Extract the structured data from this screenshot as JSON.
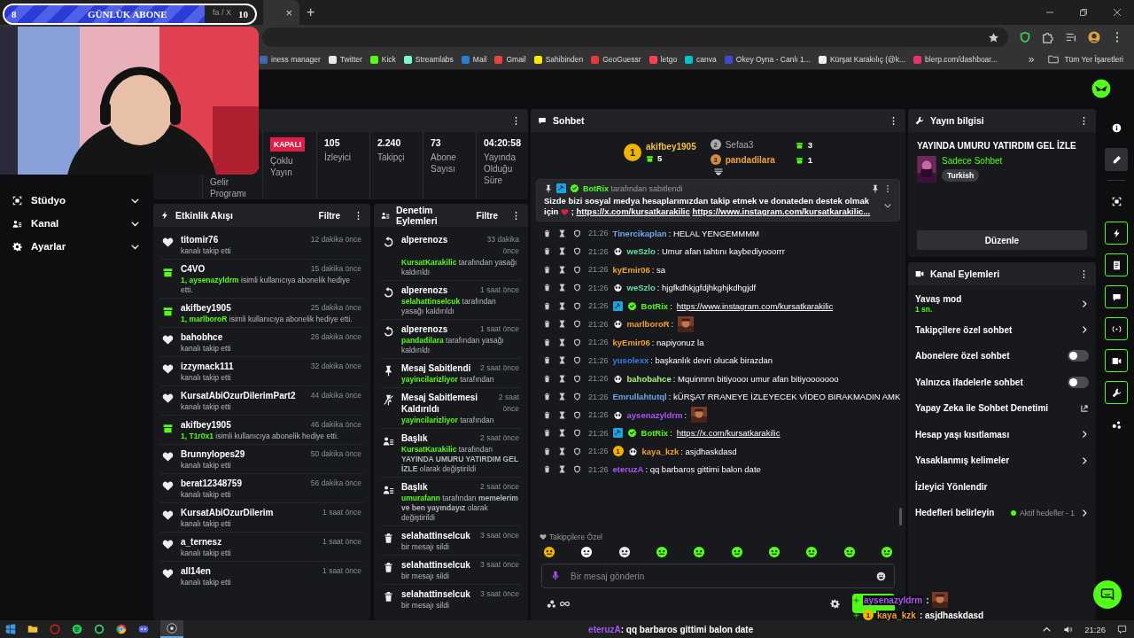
{
  "stream_overlay": {
    "goal": {
      "current": "8",
      "label": "GÜNLÜK ABONE",
      "target": "10",
      "level": 0.8
    },
    "chat": [
      {
        "user": "aysenazyldrm",
        "color": "#a855f7",
        "text": ":",
        "emote": true
      },
      {
        "user": "kaya_kzk",
        "color": "#f0a030",
        "badge": "1",
        "text": ": asjdhaskdasd"
      },
      {
        "user": "eteruzA",
        "color": "#a855f7",
        "text": ": qq barbaros gittimi balon date"
      }
    ]
  },
  "browser": {
    "tab_title": "fa / X",
    "close": "×",
    "new_tab": "+",
    "bookmarks": [
      {
        "label": "iness manager",
        "color": "#4267b2"
      },
      {
        "label": "Twitter",
        "color": "#e7e9ea"
      },
      {
        "label": "Kick",
        "color": "#53fc18"
      },
      {
        "label": "Streamlabs",
        "color": "#80f5d2"
      },
      {
        "label": "Mail",
        "color": "#2b7cd3"
      },
      {
        "label": "Gmail",
        "color": "#ea4335"
      },
      {
        "label": "Sahibinden",
        "color": "#ffe800"
      },
      {
        "label": "GeoGuessr",
        "color": "#e53935"
      },
      {
        "label": "letgo",
        "color": "#ff3f55"
      },
      {
        "label": "canva",
        "color": "#00c4cc"
      },
      {
        "label": "Okey Oyna - Canlı 1...",
        "color": "#3b4bd8"
      },
      {
        "label": "Kürşat Karakılıç (@k...",
        "color": "#eeeeee"
      },
      {
        "label": "blerp.com/dashboar...",
        "color": "#e8336a"
      }
    ],
    "more": "»",
    "all_bookmarks": "Tüm Yer İşaretleri"
  },
  "sidebar": {
    "items": [
      {
        "label": "Stüdyo",
        "expanded": false
      },
      {
        "label": "Kanal",
        "expanded": false
      },
      {
        "label": "Ayarlar",
        "expanded": false
      }
    ]
  },
  "stats": [
    {
      "kind": "label",
      "label": "Gelir Programı"
    },
    {
      "kind": "badge",
      "badge": "KAPALI",
      "label": "Çoklu Yayın"
    },
    {
      "kind": "number",
      "value": "105",
      "label": "İzleyici"
    },
    {
      "kind": "number",
      "value": "2.240",
      "label": "Takipçi"
    },
    {
      "kind": "number",
      "value": "73",
      "label": "Abone Sayısı"
    },
    {
      "kind": "number",
      "value": "04:20:58",
      "label": "Yayında Olduğu Süre"
    }
  ],
  "activity": {
    "title": "Etkinlik Akışı",
    "filter": "Filtre",
    "events": [
      {
        "kind": "follow",
        "user": "titomir76",
        "time": "12 dakika önce",
        "text": "kanalı takip etti"
      },
      {
        "kind": "gift",
        "user": "C4VO",
        "time": "15 dakika önce",
        "highlight": "1, aysenazyldrm",
        "text": "isimli kullanıcıya abonelik hediye etti."
      },
      {
        "kind": "gift",
        "user": "akifbey1905",
        "time": "25 dakika önce",
        "highlight": "1, marlboroR",
        "text": "isimli kullanıcıya abonelik hediye etti."
      },
      {
        "kind": "follow",
        "user": "bahobhce",
        "time": "26 dakika önce",
        "text": "kanalı takip etti"
      },
      {
        "kind": "follow",
        "user": "izzymack111",
        "time": "32 dakika önce",
        "text": "kanalı takip etti"
      },
      {
        "kind": "follow",
        "user": "KursatAbiOzurDilerimPart2",
        "time": "44 dakika önce",
        "text": "kanalı takip etti"
      },
      {
        "kind": "gift",
        "user": "akifbey1905",
        "time": "46 dakika önce",
        "highlight": "1, T1r0x1",
        "text": "isimli kullanıcıya abonelik hediye etti."
      },
      {
        "kind": "follow",
        "user": "Brunnylopes29",
        "time": "50 dakika önce",
        "text": "kanalı takip etti"
      },
      {
        "kind": "follow",
        "user": "berat12348759",
        "time": "56 dakika önce",
        "text": "kanalı takip etti"
      },
      {
        "kind": "follow",
        "user": "KursatAbiOzurDilerim",
        "time": "1 saat önce",
        "text": "kanalı takip etti"
      },
      {
        "kind": "follow",
        "user": "a_ternesz",
        "time": "1 saat önce",
        "text": "kanalı takip etti"
      },
      {
        "kind": "follow",
        "user": "all14en",
        "time": "1 saat önce",
        "text": "kanalı takip etti"
      }
    ]
  },
  "moderation": {
    "title": "Denetim Eylemleri",
    "filter": "Filtre",
    "actions": [
      {
        "kind": "unban",
        "title": "alperenozs",
        "time": "33 dakika önce",
        "actor": "KursatKarakilic",
        "text": "tarafından yasağı kaldırıldı"
      },
      {
        "kind": "unban",
        "title": "alperenozs",
        "time": "1 saat önce",
        "actor": "selahattinselcuk",
        "text": "tarafından yasağı kaldırıldı"
      },
      {
        "kind": "unban",
        "title": "alperenozs",
        "time": "1 saat önce",
        "actor": "pandadilara",
        "text": "tarafından yasağı kaldırıldı"
      },
      {
        "kind": "pin",
        "title": "Mesaj Sabitlendi",
        "time": "2 saat önce",
        "actor": "yayincilarizliyor",
        "text": "tarafından"
      },
      {
        "kind": "unpin",
        "title": "Mesaj Sabitlemesi Kaldırıldı",
        "time": "2 saat önce",
        "actor": "yayincilarizliyor",
        "text": "tarafından"
      },
      {
        "kind": "title",
        "title": "Başlık",
        "time": "2 saat önce",
        "actor": "KursatKarakilic",
        "text": "tarafından **YAYINDA UMURU YATIRDIM GEL İZLE** olarak değiştirildi"
      },
      {
        "kind": "title",
        "title": "Başlık",
        "time": "2 saat önce",
        "actor": "umurafann",
        "text": "tarafından **memelerim ve ben yayındayız** olarak değiştirildi"
      },
      {
        "kind": "delete",
        "title": "selahattinselcuk",
        "time": "3 saat önce",
        "text": "bir mesajı sildi"
      },
      {
        "kind": "delete",
        "title": "selahattinselcuk",
        "time": "3 saat önce",
        "text": "bir mesajı sildi"
      },
      {
        "kind": "delete",
        "title": "selahattinselcuk",
        "time": "3 saat önce",
        "text": "bir mesajı sildi"
      }
    ]
  },
  "chat": {
    "title": "Sohbet",
    "leaders": [
      {
        "rank": "1",
        "user": "akifbey1905",
        "count": "5"
      },
      {
        "rank": "2",
        "user": "Sefaa3",
        "count": "3"
      },
      {
        "rank": "3",
        "user": "pandadilara",
        "count": "1"
      }
    ],
    "pinned": {
      "by": "BotRix",
      "by_text": "tarafından sabitlendi",
      "text": "Sizde bizi sosyal medya hesaplarımızdan takip etmek ve donateden destek olmak için",
      "after_heart": ";",
      "links": [
        "https://x.com/kursatkarakilic",
        "https://www.instagram.com/kursatkarakilic..."
      ]
    },
    "messages": [
      {
        "time": "21:26",
        "user": "Tinercikaplan",
        "color": "#6fa8e8",
        "text": ": HELAL YENGEMMMM"
      },
      {
        "time": "21:26",
        "user": "weSzlo",
        "color": "#5ee0a0",
        "badges": [
          {
            "kind": "panda"
          }
        ],
        "text": ": Umur afan tahtını kaybediyooorrr"
      },
      {
        "time": "21:26",
        "user": "kyEmir06",
        "color": "#f0a030",
        "text": ": sa"
      },
      {
        "time": "21:26",
        "user": "weSzlo",
        "color": "#5ee0a0",
        "badges": [
          {
            "kind": "panda"
          }
        ],
        "text": ": hjgfkdhkjgfdjhkghjkdhgjdf"
      },
      {
        "time": "21:26",
        "user": "BotRix",
        "color": "#53fc18",
        "badges": [
          {
            "kind": "bot"
          },
          {
            "kind": "verified"
          }
        ],
        "text": ":",
        "link": "https://www.instagram.com/kursatkarakilic"
      },
      {
        "time": "21:26",
        "user": "marlboroR",
        "color": "#f0a030",
        "badges": [
          {
            "kind": "panda"
          }
        ],
        "text": ":",
        "emote": true
      },
      {
        "time": "21:26",
        "user": "kyEmir06",
        "color": "#f0a030",
        "text": ": napiyonuz la"
      },
      {
        "time": "21:26",
        "user": "yusolexx",
        "color": "#3b7be8",
        "text": ": başkanlık devri olucak birazdan"
      },
      {
        "time": "21:26",
        "user": "bahobahce",
        "color": "#a8f07a",
        "badges": [
          {
            "kind": "panda"
          }
        ],
        "text": ": Mquinnnn bitiyoooı umur afan bitiyooooooo"
      },
      {
        "time": "21:26",
        "user": "Emrullahtutql",
        "color": "#6aa7e8",
        "text": ": kÜRŞAT RRANEYE İZLEYECEK VİDEO BIRAKMADIN AMK"
      },
      {
        "time": "21:26",
        "user": "aysenazyldrm",
        "color": "#a855f7",
        "badges": [
          {
            "kind": "panda"
          }
        ],
        "text": ":",
        "emote": true
      },
      {
        "time": "21:26",
        "user": "BotRix",
        "color": "#53fc18",
        "badges": [
          {
            "kind": "bot"
          },
          {
            "kind": "verified"
          }
        ],
        "text": ":",
        "link": "https://x.com/kursatkarakilic"
      },
      {
        "time": "21:26",
        "user": "kaya_kzk",
        "color": "#f0a030",
        "badges": [
          {
            "kind": "sub",
            "label": "1"
          },
          {
            "kind": "panda"
          }
        ],
        "text": ": asjdhaskdasd"
      },
      {
        "time": "21:26",
        "user": "eteruzA",
        "color": "#a855f7",
        "text": ": qq barbaros gittimi balon date"
      }
    ],
    "emote_section": "Takipçilere Özel",
    "placeholder": "Bir mesaj gönderin"
  },
  "stream_info": {
    "title": "Yayın bilgisi",
    "stream_title": "YAYINDA UMURU YATIRDIM GEL İZLE",
    "category": "Sadece Sohbet",
    "tag": "Turkish",
    "edit": "Düzenle"
  },
  "channel_actions": {
    "title": "Kanal Eylemleri",
    "items": [
      {
        "kind": "link",
        "label": "Yavaş mod",
        "sub": "1 sn."
      },
      {
        "kind": "link",
        "label": "Takipçilere özel sohbet"
      },
      {
        "kind": "toggle",
        "label": "Abonelere özel sohbet",
        "on": false
      },
      {
        "kind": "toggle",
        "label": "Yalnızca ifadelerle sohbet",
        "on": false
      },
      {
        "kind": "external",
        "label": "Yapay Zeka ile Sohbet Denetimi"
      },
      {
        "kind": "link",
        "label": "Hesap yaşı kısıtlaması"
      },
      {
        "kind": "link",
        "label": "Yasaklanmış kelimeler"
      },
      {
        "kind": "plain",
        "label": "İzleyici Yönlendir"
      },
      {
        "kind": "status",
        "label": "Hedefleri belirleyin",
        "status": "Aktif hedefler - 1"
      }
    ]
  },
  "rail": [
    {
      "selected": false
    },
    {
      "selected": true
    },
    {
      "selected": false
    },
    {
      "selected": false
    },
    {
      "selected": false
    },
    {
      "selected": false
    },
    {
      "selected": false
    },
    {
      "selected": false
    },
    {
      "selected": false
    },
    {
      "selected": false
    }
  ],
  "taskbar": {
    "time": "21:26"
  }
}
